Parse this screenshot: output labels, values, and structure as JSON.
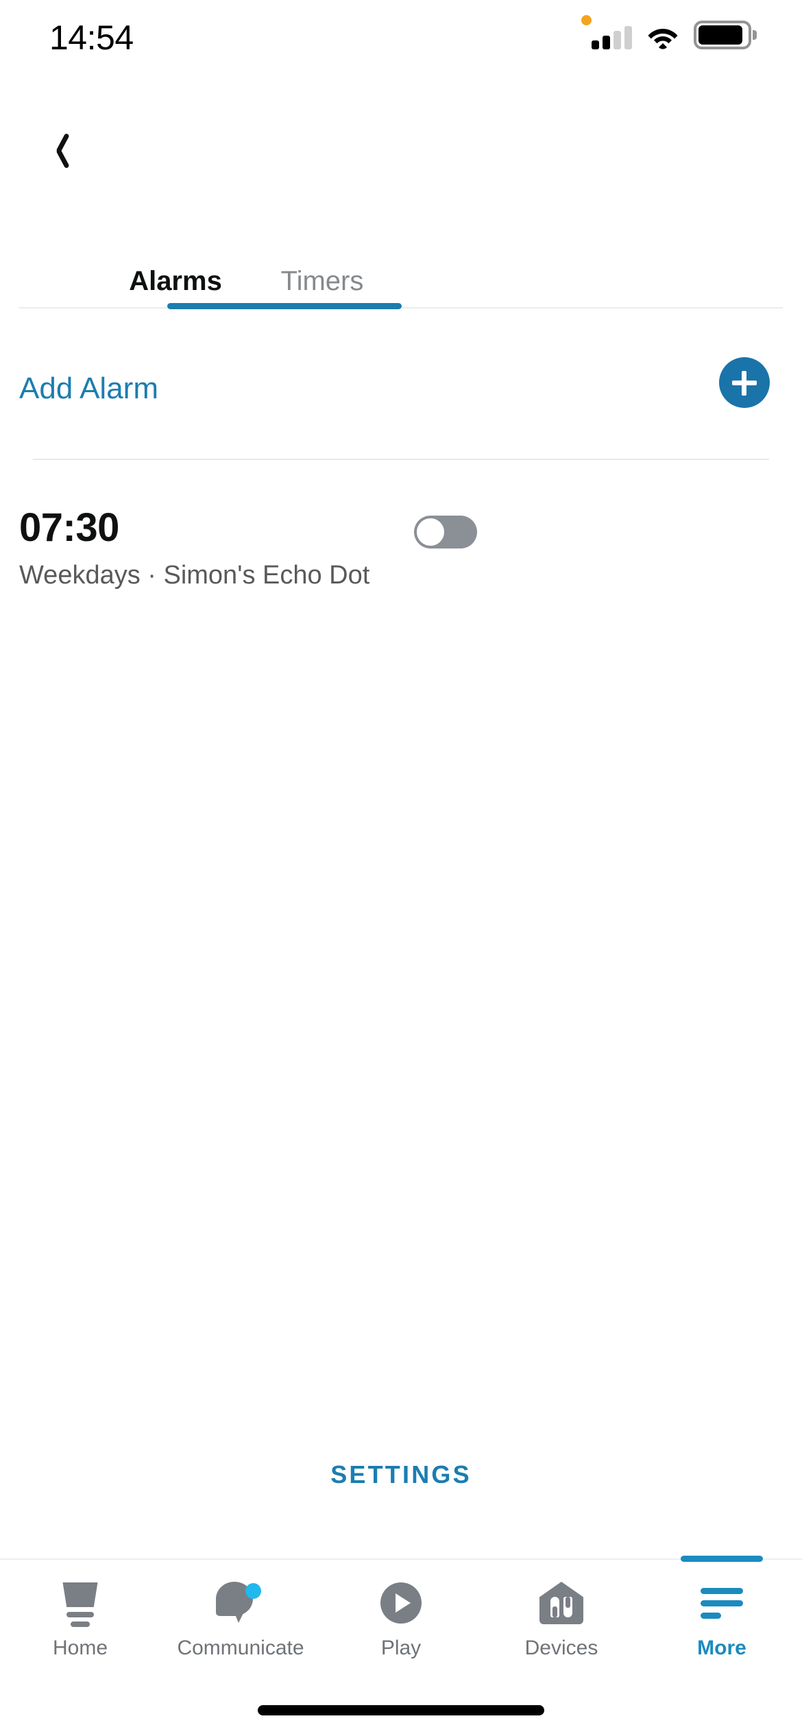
{
  "status_bar": {
    "time": "14:54",
    "mic_indicator": "orange-dot",
    "signal_bars_filled": 2,
    "signal_bars_total": 4,
    "wifi": "wifi-icon",
    "battery": "battery-full-icon"
  },
  "nav": {
    "back_icon": "chevron-left-icon"
  },
  "tabs": {
    "items": [
      {
        "label": "Alarms",
        "active": true
      },
      {
        "label": "Timers",
        "active": false
      }
    ]
  },
  "add_alarm": {
    "label": "Add Alarm",
    "button_icon": "plus-icon"
  },
  "alarms": [
    {
      "time": "07:30",
      "subtitle": "Weekdays · Simon's Echo Dot",
      "enabled": false
    }
  ],
  "settings": {
    "label": "SETTINGS"
  },
  "bottom_nav": {
    "items": [
      {
        "label": "Home",
        "icon": "echo-device-icon",
        "active": false,
        "badge": false
      },
      {
        "label": "Communicate",
        "icon": "speech-bubble-icon",
        "active": false,
        "badge": true
      },
      {
        "label": "Play",
        "icon": "play-circle-icon",
        "active": false,
        "badge": false
      },
      {
        "label": "Devices",
        "icon": "house-bulbs-icon",
        "active": false,
        "badge": false
      },
      {
        "label": "More",
        "icon": "hamburger-menu-icon",
        "active": true,
        "badge": false
      }
    ]
  },
  "colors": {
    "accent_blue": "#1B7DB0",
    "tab_active_blue": "#1B8BBF",
    "badge_cyan": "#21B8EE",
    "icon_gray": "#7A7E85",
    "text_primary": "#0F1111",
    "text_secondary": "#58595B",
    "toggle_off_track": "#8B8F96",
    "mic_orange": "#F3A420"
  }
}
